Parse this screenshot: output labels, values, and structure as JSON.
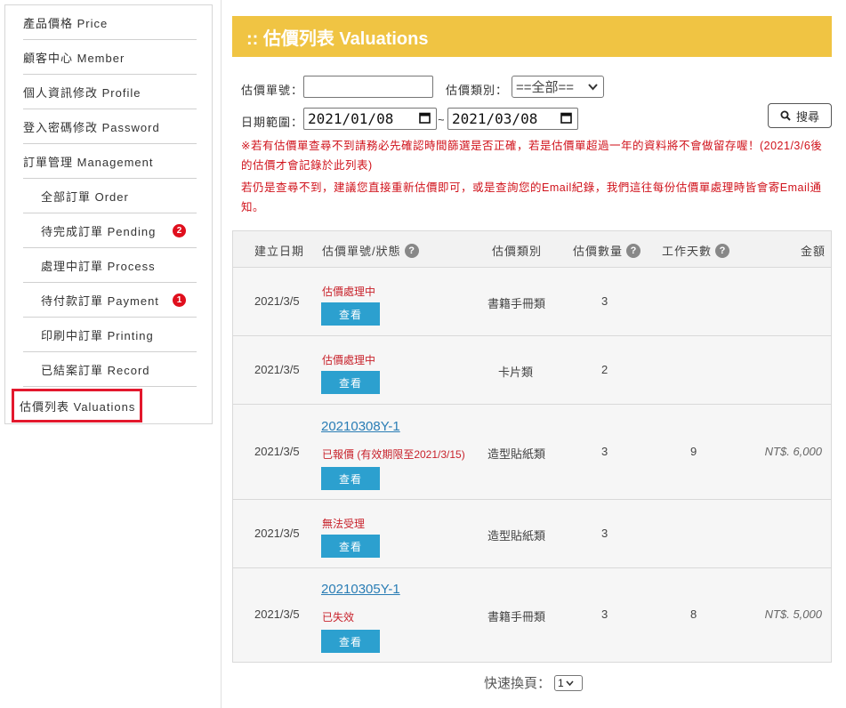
{
  "sidebar": {
    "items": [
      {
        "label": "產品價格 Price",
        "badge": ""
      },
      {
        "label": "顧客中心 Member",
        "badge": ""
      },
      {
        "label": "個人資訊修改 Profile",
        "badge": ""
      },
      {
        "label": "登入密碼修改 Password",
        "badge": ""
      },
      {
        "label": "訂單管理 Management",
        "badge": ""
      },
      {
        "label": "全部訂單 Order",
        "badge": ""
      },
      {
        "label": "待完成訂單 Pending",
        "badge": "2"
      },
      {
        "label": "處理中訂單 Process",
        "badge": ""
      },
      {
        "label": "待付款訂單 Payment",
        "badge": "1"
      },
      {
        "label": "印刷中訂單 Printing",
        "badge": ""
      },
      {
        "label": "已結案訂單 Record",
        "badge": ""
      }
    ],
    "active": "估價列表 Valuations"
  },
  "header": {
    "title": ":: 估價列表 Valuations"
  },
  "filters": {
    "order_no_label": "估價單號：",
    "order_no_value": "",
    "type_label": "估價類別：",
    "type_selected": "==全部==",
    "date_label": "日期範圍：",
    "date_from": "2021/01/08",
    "date_sep": "~",
    "date_to": "2021/03/08",
    "search_label": "搜尋"
  },
  "notice": {
    "line1": "※若有估價單查尋不到請務必先確認時間篩選是否正確，若是估價單超過一年的資料將不會做留存喔！(2021/3/6後的估價才會記錄於此列表)",
    "line2": "若仍是查尋不到，建議您直接重新估價即可，或是查詢您的Email紀錄，我們這往每份估價單處理時皆會寄Email通知。"
  },
  "table": {
    "headers": {
      "created": "建立日期",
      "number_status": "估價單號/狀態",
      "category": "估價類別",
      "quantity": "估價數量",
      "work_days": "工作天數",
      "amount": "金額"
    },
    "view_label": "查看",
    "rows": [
      {
        "date": "2021/3/5",
        "number": "",
        "status": "估價處理中",
        "category": "書籍手冊類",
        "quantity": "3",
        "days": "",
        "amount": ""
      },
      {
        "date": "2021/3/5",
        "number": "",
        "status": "估價處理中",
        "category": "卡片類",
        "quantity": "2",
        "days": "",
        "amount": ""
      },
      {
        "date": "2021/3/5",
        "number": "20210308Y-1",
        "status": "已報價 (有效期限至2021/3/15)",
        "category": "造型貼紙類",
        "quantity": "3",
        "days": "9",
        "amount": "NT$. 6,000"
      },
      {
        "date": "2021/3/5",
        "number": "",
        "status": "無法受理",
        "category": "造型貼紙類",
        "quantity": "3",
        "days": "",
        "amount": ""
      },
      {
        "date": "2021/3/5",
        "number": "20210305Y-1",
        "status": "已失效",
        "category": "書籍手冊類",
        "quantity": "3",
        "days": "8",
        "amount": "NT$. 5,000"
      }
    ]
  },
  "pager": {
    "label": "快速換頁：",
    "page": "1"
  },
  "icons": [
    "calendar-icon",
    "search-icon",
    "help-icon",
    "chevron-down-icon"
  ],
  "colors": {
    "header_bg": "#f0c443",
    "view_button": "#2ca0cf",
    "badge": "#e00f1d",
    "notice": "#d0121b",
    "active_outline": "#e3182d"
  }
}
